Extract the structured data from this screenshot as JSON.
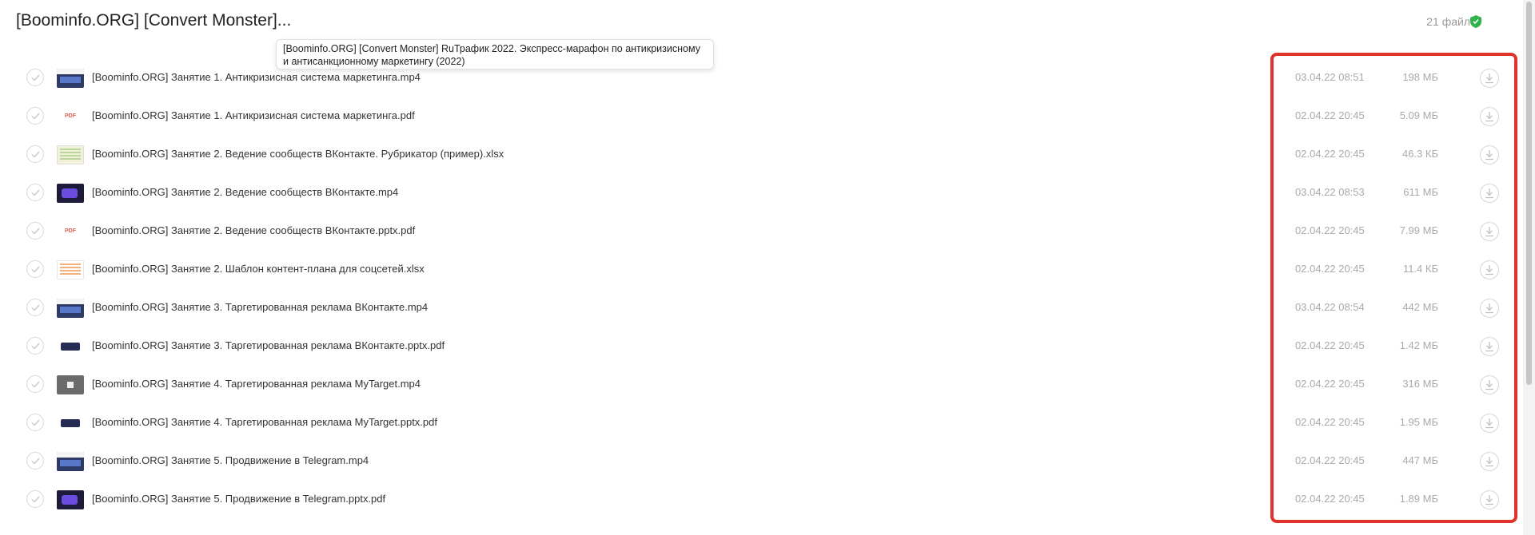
{
  "header": {
    "title": "[Boominfo.ORG] [Convert Monster]...",
    "file_count": "21 файл"
  },
  "tooltip": {
    "text": "[Boominfo.ORG] [Convert Monster] RuТрафик 2022. Экспресс-марафон по антикризисному и антисанкционному маркетингу (2022)"
  },
  "files": [
    {
      "name": "[Boominfo.ORG] Занятие 1. Антикризисная система маркетинга.mp4",
      "date": "03.04.22 08:51",
      "size": "198 МБ",
      "thumb": "video"
    },
    {
      "name": "[Boominfo.ORG] Занятие 1. Антикризисная система маркетинга.pdf",
      "date": "02.04.22 20:45",
      "size": "5.09 МБ",
      "thumb": "pdf"
    },
    {
      "name": "[Boominfo.ORG] Занятие 2. Ведение сообществ ВКонтакте. Рубрикатор (пример).xlsx",
      "date": "02.04.22 20:45",
      "size": "46.3 КБ",
      "thumb": "sheet"
    },
    {
      "name": "[Boominfo.ORG] Занятие 2. Ведение сообществ ВКонтакте.mp4",
      "date": "03.04.22 08:53",
      "size": "611 МБ",
      "thumb": "dark"
    },
    {
      "name": "[Boominfo.ORG] Занятие 2. Ведение сообществ ВКонтакте.pptx.pdf",
      "date": "02.04.22 20:45",
      "size": "7.99 МБ",
      "thumb": "pdf"
    },
    {
      "name": "[Boominfo.ORG] Занятие 2. Шаблон контент-плана для соцсетей.xlsx",
      "date": "02.04.22 20:45",
      "size": "11.4 КБ",
      "thumb": "sheet2"
    },
    {
      "name": "[Boominfo.ORG] Занятие 3. Таргетированная реклама ВКонтакте.mp4",
      "date": "03.04.22 08:54",
      "size": "442 МБ",
      "thumb": "video"
    },
    {
      "name": "[Boominfo.ORG] Занятие 3. Таргетированная реклама ВКонтакте.pptx.pdf",
      "date": "02.04.22 20:45",
      "size": "1.42 МБ",
      "thumb": "slide"
    },
    {
      "name": "[Boominfo.ORG] Занятие 4. Таргетированная реклама MyTarget.mp4",
      "date": "02.04.22 20:45",
      "size": "316 МБ",
      "thumb": "grey"
    },
    {
      "name": "[Boominfo.ORG] Занятие 4. Таргетированная реклама MyTarget.pptx.pdf",
      "date": "02.04.22 20:45",
      "size": "1.95 МБ",
      "thumb": "slide"
    },
    {
      "name": "[Boominfo.ORG] Занятие 5. Продвижение в Telegram.mp4",
      "date": "02.04.22 20:45",
      "size": "447 МБ",
      "thumb": "video"
    },
    {
      "name": "[Boominfo.ORG] Занятие 5. Продвижение в Telegram.pptx.pdf",
      "date": "02.04.22 20:45",
      "size": "1.89 МБ",
      "thumb": "dark"
    }
  ],
  "colors": {
    "highlight": "#e0312c",
    "shield": "#2fb34a"
  }
}
